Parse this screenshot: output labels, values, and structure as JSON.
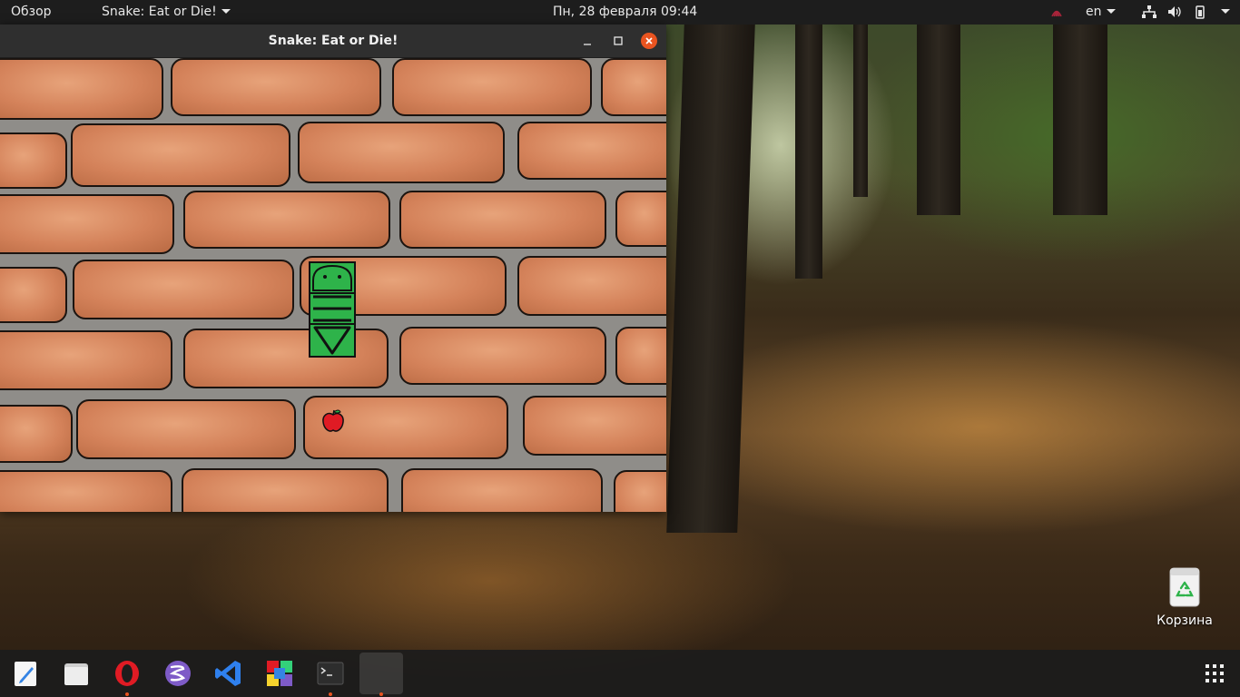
{
  "topbar": {
    "activities": "Обзор",
    "app_menu": "Snake: Eat or Die!",
    "datetime": "Пн, 28 февраля  09:44",
    "keyboard_layout": "en",
    "icons": [
      "network-icon",
      "volume-icon",
      "battery-icon",
      "system-menu-caret-icon"
    ]
  },
  "window": {
    "title": "Snake: Eat or Die!",
    "buttons": [
      "minimize",
      "maximize",
      "close"
    ]
  },
  "game": {
    "snake_segments": 3,
    "food": "apple"
  },
  "desktop": {
    "trash_label": "Корзина"
  },
  "dock": {
    "items": [
      "text-editor",
      "files",
      "opera-browser",
      "emacs",
      "vscode",
      "game-app",
      "terminal",
      "snake-game"
    ],
    "apps_grid": "show-applications"
  },
  "colors": {
    "close_button": "#e95420",
    "snake_green": "#2eb34a",
    "brick": "#d4825a"
  }
}
